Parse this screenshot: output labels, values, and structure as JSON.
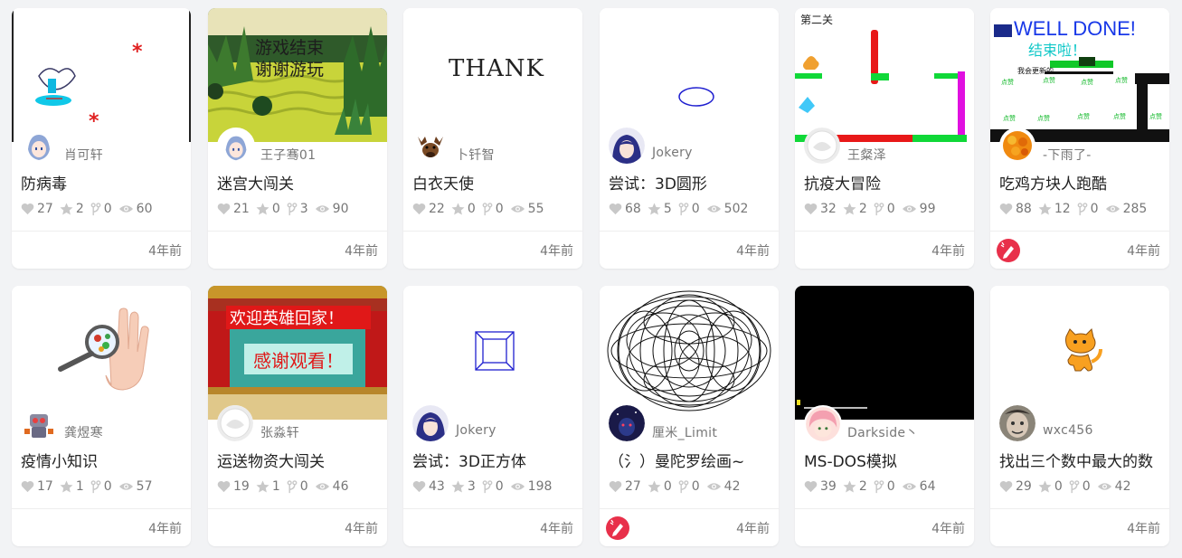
{
  "projects": [
    {
      "title": "防病毒",
      "author": "肖可轩",
      "likes": "27",
      "favorites": "2",
      "forks": "0",
      "views": "60",
      "time": "4年前"
    },
    {
      "title": "迷宫大闯关",
      "author": "王子骞01",
      "likes": "21",
      "favorites": "0",
      "forks": "3",
      "views": "90",
      "time": "4年前",
      "thumb_text": [
        "游戏结束",
        "谢谢游玩"
      ]
    },
    {
      "title": "白衣天使",
      "author": "卜钎智",
      "likes": "22",
      "favorites": "0",
      "forks": "0",
      "views": "55",
      "time": "4年前",
      "thumb_text": [
        "THANK"
      ]
    },
    {
      "title": "尝试：3D圆形",
      "author": "Jokery",
      "likes": "68",
      "favorites": "5",
      "forks": "0",
      "views": "502",
      "time": "4年前"
    },
    {
      "title": "抗疫大冒险",
      "author": "王粲泽",
      "likes": "32",
      "favorites": "2",
      "forks": "0",
      "views": "99",
      "time": "4年前",
      "thumb_text": [
        "第二关"
      ]
    },
    {
      "title": "吃鸡方块人跑酷",
      "author": "-下雨了-",
      "likes": "88",
      "favorites": "12",
      "forks": "0",
      "views": "285",
      "time": "4年前",
      "badge": "featured-badge-icon",
      "thumb_text": [
        "WELL DONE!",
        "结束啦！",
        "我会更新的",
        "点赞"
      ]
    },
    {
      "title": "疫情小知识",
      "author": "龚煜寒",
      "likes": "17",
      "favorites": "1",
      "forks": "0",
      "views": "57",
      "time": "4年前"
    },
    {
      "title": "运送物资大闯关",
      "author": "张淼轩",
      "likes": "19",
      "favorites": "1",
      "forks": "0",
      "views": "46",
      "time": "4年前",
      "thumb_text": [
        "欢迎英雄回家！",
        "感谢观看！"
      ]
    },
    {
      "title": "尝试：3D正方体",
      "author": "Jokery",
      "likes": "43",
      "favorites": "3",
      "forks": "0",
      "views": "198",
      "time": "4年前"
    },
    {
      "title": "（氵）曼陀罗绘画~",
      "author": "厘米_Limit",
      "likes": "27",
      "favorites": "0",
      "forks": "0",
      "views": "42",
      "time": "4年前",
      "badge": "featured-badge-icon"
    },
    {
      "title": "MS-DOS模拟",
      "author": "Darkside丶",
      "likes": "39",
      "favorites": "2",
      "forks": "0",
      "views": "64",
      "time": "4年前"
    },
    {
      "title": "找出三个数中最大的数",
      "author": "wxc456",
      "likes": "29",
      "favorites": "0",
      "forks": "0",
      "views": "42",
      "time": "4年前"
    }
  ],
  "colors": {
    "background": "#f2f3f5",
    "card": "#ffffff",
    "badge": "#e8304a",
    "stat_icon": "#c8c8c8"
  }
}
